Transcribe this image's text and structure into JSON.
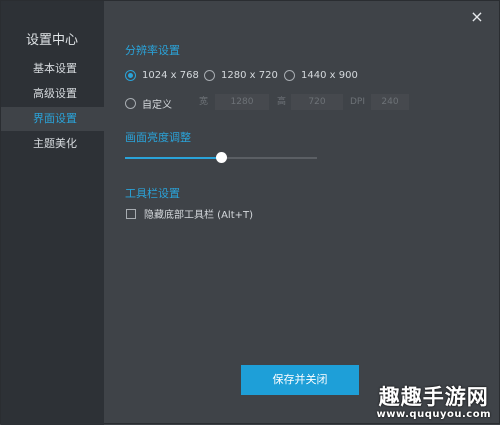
{
  "sidebar": {
    "title": "设置中心",
    "items": [
      {
        "label": "基本设置",
        "active": false
      },
      {
        "label": "高级设置",
        "active": false
      },
      {
        "label": "界面设置",
        "active": true
      },
      {
        "label": "主题美化",
        "active": false
      }
    ]
  },
  "close_icon": "×",
  "resolution": {
    "title": "分辨率设置",
    "options": [
      "1024 x 768",
      "1280 x 720",
      "1440 x 900"
    ],
    "selected": "1024 x 768",
    "custom_label": "自定义",
    "width_label": "宽",
    "width_value": "1280",
    "height_label": "高",
    "height_value": "720",
    "dpi_label": "DPI",
    "dpi_value": "240"
  },
  "brightness": {
    "title": "画面亮度调整",
    "value_fraction": 0.5
  },
  "toolbar": {
    "title": "工具栏设置",
    "hide_bottom_label": "隐藏底部工具栏 (Alt+T)",
    "hide_bottom_checked": false
  },
  "save_button": "保存并关闭",
  "watermark": {
    "main": "趣趣手游网",
    "sub": "www.ququyou.com"
  },
  "colors": {
    "accent": "#2aa3d9",
    "button": "#1e9fd8",
    "sidebar_bg": "#2d3136",
    "content_bg": "#3f4348"
  }
}
